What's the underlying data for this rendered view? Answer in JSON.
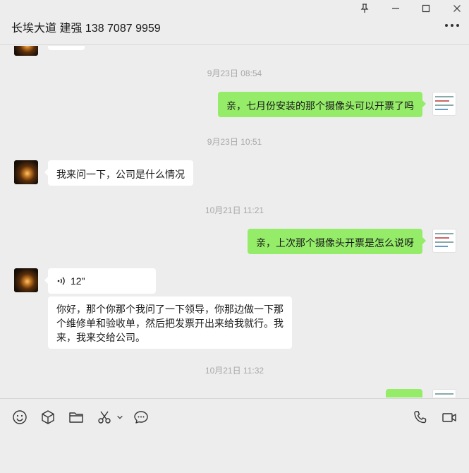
{
  "window": {
    "title": "长埃大道 建强 138 7087 9959",
    "controls": [
      "pin-icon",
      "minimize-icon",
      "maximize-icon",
      "close-icon"
    ]
  },
  "messages": {
    "t1": "9月23日 08:54",
    "m1": "亲，七月份安装的那个摄像头可以开票了吗",
    "t2": "9月23日 10:51",
    "m2": "我来问一下，公司是什么情况",
    "t3": "10月21日 11:21",
    "m3": "亲，上次那个摄像头开票是怎么说呀",
    "voice_duration": "12\"",
    "m4": "你好，那个你那个我问了一下领导，你那边做一下那个维修单和验收单，然后把发票开出来给我就行。我来，我来交给公司。",
    "t4": "10月21日 11:32"
  },
  "colors": {
    "self_bubble": "#95ec69",
    "other_bubble": "#ffffff",
    "background": "#ededed"
  },
  "toolbar": {
    "icons": [
      "emoji-icon",
      "box-icon",
      "folder-icon",
      "scissors-icon",
      "chat-bubble-icon",
      "phone-icon",
      "video-icon"
    ]
  }
}
